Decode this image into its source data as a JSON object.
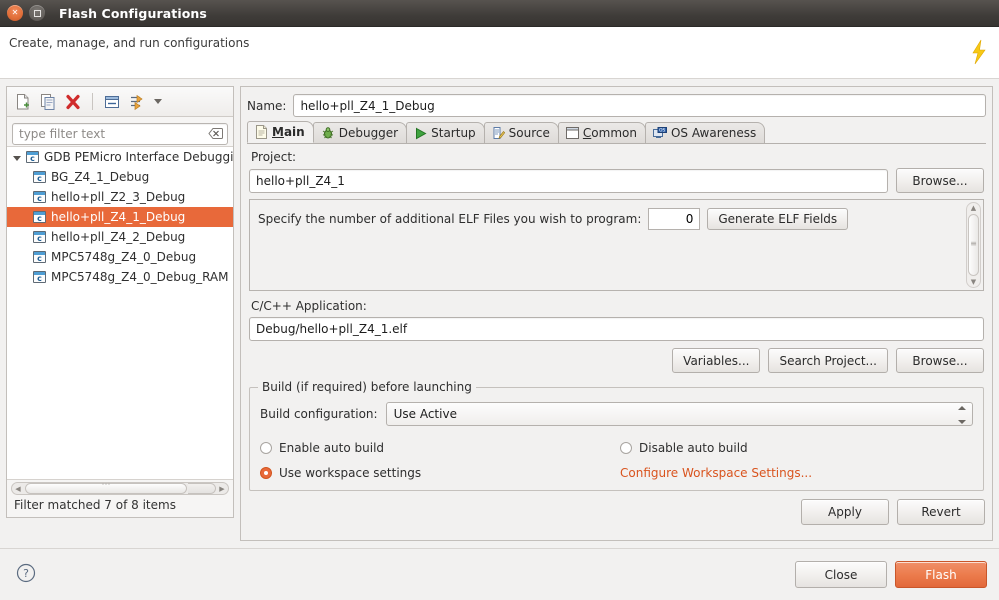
{
  "window": {
    "title": "Flash Configurations",
    "close_icon": "close-icon",
    "maximize_icon": "maximize-icon"
  },
  "header": {
    "subtitle": "Create, manage, and run configurations",
    "banner_icon": "lightning-bolt-icon"
  },
  "left_panel": {
    "toolbar": [
      {
        "name": "new-configuration-button",
        "icon": "new-document-icon",
        "tooltip": "New launch configuration"
      },
      {
        "name": "duplicate-configuration-button",
        "icon": "duplicate-icon",
        "tooltip": "Duplicate"
      },
      {
        "name": "delete-configuration-button",
        "icon": "delete-red-x-icon",
        "tooltip": "Delete"
      },
      {
        "name": "collapse-all-button",
        "icon": "collapse-all-icon",
        "tooltip": "Collapse All"
      },
      {
        "name": "filter-launch-configurations-button",
        "icon": "filter-icon",
        "tooltip": "Filter launch configurations"
      },
      {
        "name": "view-menu-button",
        "icon": "chevron-down-icon",
        "tooltip": "View Menu"
      }
    ],
    "filter": {
      "placeholder": "type filter text",
      "value": "",
      "clear_icon": "clear-icon"
    },
    "tree": {
      "root": {
        "label": "GDB PEMicro Interface Debuggin",
        "icon": "c-config-icon",
        "expanded": true
      },
      "children": [
        {
          "label": "BG_Z4_1_Debug",
          "icon": "c-config-icon",
          "selected": false
        },
        {
          "label": "hello+pll_Z2_3_Debug",
          "icon": "c-config-icon",
          "selected": false
        },
        {
          "label": "hello+pll_Z4_1_Debug",
          "icon": "c-config-icon",
          "selected": true
        },
        {
          "label": "hello+pll_Z4_2_Debug",
          "icon": "c-config-icon",
          "selected": false
        },
        {
          "label": "MPC5748g_Z4_0_Debug",
          "icon": "c-config-icon",
          "selected": false
        },
        {
          "label": "MPC5748g_Z4_0_Debug_RAM",
          "icon": "c-config-icon",
          "selected": false
        }
      ]
    },
    "status": "Filter matched 7 of 8 items"
  },
  "right_panel": {
    "name_label": "Name:",
    "name_value": "hello+pll_Z4_1_Debug",
    "tabs": [
      {
        "label": "Main",
        "icon": "document-icon",
        "active": true,
        "mnemonic": "M"
      },
      {
        "label": "Debugger",
        "icon": "bug-icon",
        "active": false
      },
      {
        "label": "Startup",
        "icon": "green-play-icon",
        "active": false
      },
      {
        "label": "Source",
        "icon": "source-edit-icon",
        "active": false
      },
      {
        "label": "Common",
        "icon": "window-icon",
        "active": false,
        "mnemonic": "C"
      },
      {
        "label": "OS Awareness",
        "icon": "os-badge-icon",
        "active": false
      }
    ],
    "main_tab": {
      "project_label": "Project:",
      "project_value": "hello+pll_Z4_1",
      "project_browse_label": "Browse...",
      "elf": {
        "text": "Specify the number of additional ELF Files you wish to program:",
        "count_value": "0",
        "generate_label": "Generate ELF Fields"
      },
      "application_label": "C/C++ Application:",
      "application_value": "Debug/hello+pll_Z4_1.elf",
      "application_buttons": [
        "Variables...",
        "Search Project...",
        "Browse..."
      ],
      "build_group": {
        "title": "Build (if required) before launching",
        "build_config_label": "Build configuration:",
        "build_config_value": "Use Active",
        "options": [
          {
            "label": "Enable auto build",
            "checked": false
          },
          {
            "label": "Disable auto build",
            "checked": false
          },
          {
            "label": "Use workspace settings",
            "checked": true
          }
        ],
        "configure_link": "Configure Workspace Settings..."
      }
    },
    "apply_label": "Apply",
    "revert_label": "Revert"
  },
  "footer": {
    "help_icon": "help-icon",
    "close_label": "Close",
    "flash_label": "Flash"
  },
  "colors": {
    "accent_orange": "#e8693a",
    "link_orange": "#d9541e",
    "titlebar": "#3f3c39",
    "panel_bg": "#f2f1f0"
  }
}
